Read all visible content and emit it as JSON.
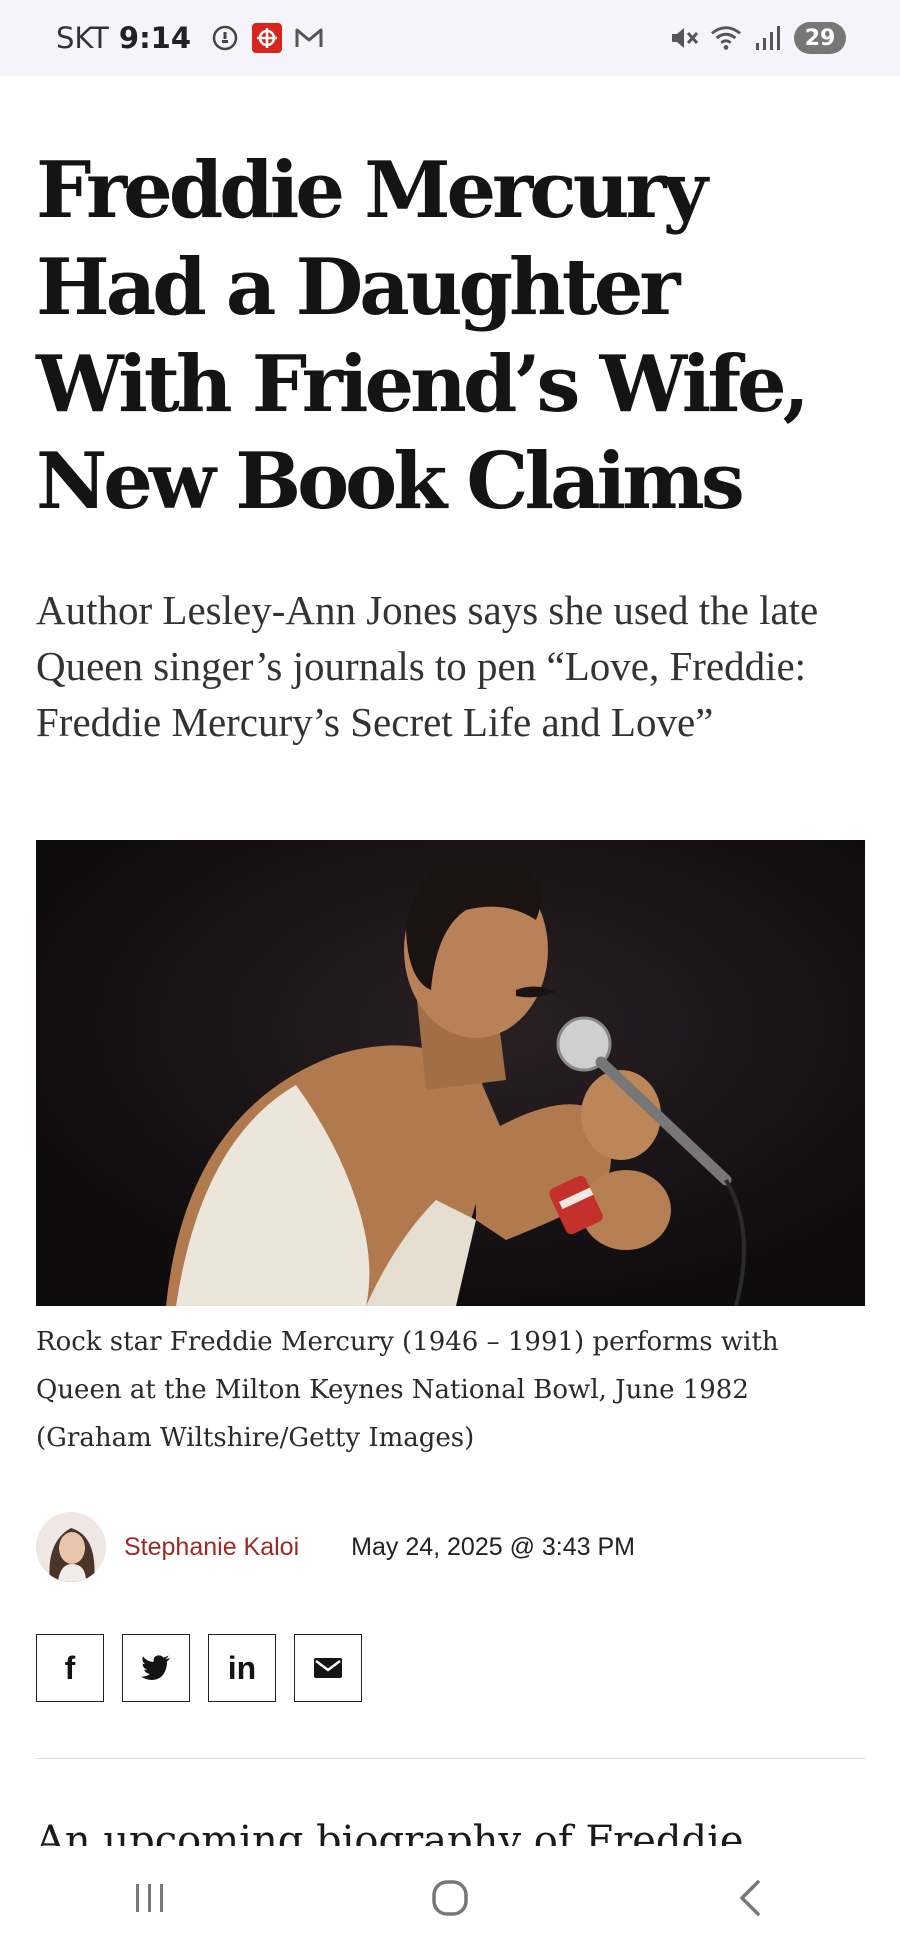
{
  "status_bar": {
    "carrier": "SKT",
    "time": "9:14",
    "battery": "29",
    "left_icons": [
      "alarm-icon",
      "target-app-icon",
      "gmail-icon"
    ],
    "right_icons": [
      "mute-icon",
      "wifi-icon",
      "signal-icon"
    ]
  },
  "article": {
    "headline": "Freddie Mercury Had a Daughter With Friend’s Wife, New Book Claims",
    "dek": "Author Lesley-Ann Jones says she used the late Queen singer’s journals to pen “Love, Freddie: Freddie Mercury’s Secret Life and Love”",
    "caption": "Rock star Freddie Mercury (1946 – 1991) performs with Queen at the Milton Keynes National Bowl, June 1982 (Graham Wiltshire/Getty Images)",
    "author": "Stephanie Kaloi",
    "date": "May 24, 2025 @ 3:43 PM",
    "body_start": "An upcoming biography of Freddie Mercury"
  },
  "share": {
    "facebook": "f",
    "linkedin": "in"
  },
  "colors": {
    "author": "#9a2b22",
    "statusbar_bg": "#f6f4fb",
    "text": "#141414"
  }
}
